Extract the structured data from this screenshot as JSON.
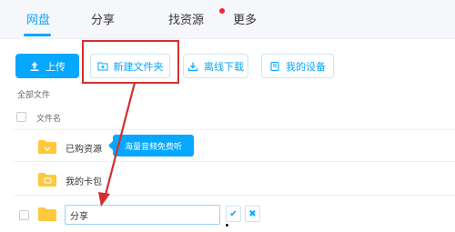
{
  "nav": {
    "tabs": [
      {
        "label": "网盘",
        "active": true
      },
      {
        "label": "分享",
        "active": false
      },
      {
        "label": "找资源",
        "active": false,
        "has_dot": true
      },
      {
        "label": "更多",
        "active": false
      }
    ]
  },
  "toolbar": {
    "upload_label": "上传",
    "new_folder_label": "新建文件夹",
    "offline_download_label": "离线下载",
    "my_devices_label": "我的设备"
  },
  "breadcrumb": "全部文件",
  "list": {
    "column_name_header": "文件名",
    "rows": [
      {
        "name": "已购资源"
      },
      {
        "name": "我的卡包"
      }
    ],
    "rename_value": "分享"
  },
  "tooltip": "海量音频免费听",
  "colors": {
    "accent": "#06a7ff",
    "highlight": "#d32f2f",
    "folder": "#ffc83d"
  }
}
